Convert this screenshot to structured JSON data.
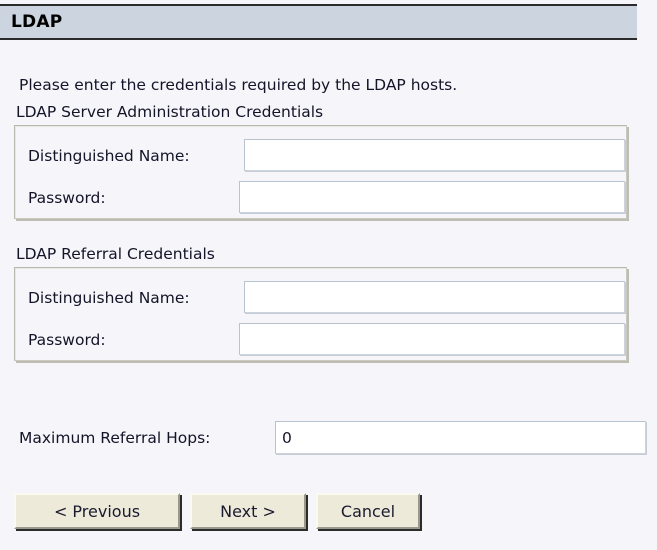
{
  "window": {
    "title": "LDAP"
  },
  "content": {
    "intro_text": "Please enter the credentials required by the LDAP hosts.",
    "groups": [
      {
        "label": "LDAP Server Administration Credentials",
        "fields": [
          {
            "label": "Distinguished Name:",
            "value": "",
            "placeholder": ""
          },
          {
            "label": "Password:",
            "value": "",
            "placeholder": ""
          }
        ]
      },
      {
        "label": "LDAP Referral Credentials",
        "fields": [
          {
            "label": "Distinguished Name:",
            "value": "",
            "placeholder": ""
          },
          {
            "label": "Password:",
            "value": "",
            "placeholder": ""
          }
        ]
      }
    ],
    "hops": {
      "label": "Maximum Referral Hops:",
      "value": "0",
      "placeholder": ""
    }
  },
  "buttons": {
    "previous": "< Previous",
    "next": "Next >",
    "cancel": "Cancel"
  },
  "colors": {
    "titlebar_bg": "#ccd4e0",
    "body_bg": "#f5f5fa",
    "button_bg": "#edeada",
    "text": "#141428",
    "input_bg": "#ffffff"
  }
}
